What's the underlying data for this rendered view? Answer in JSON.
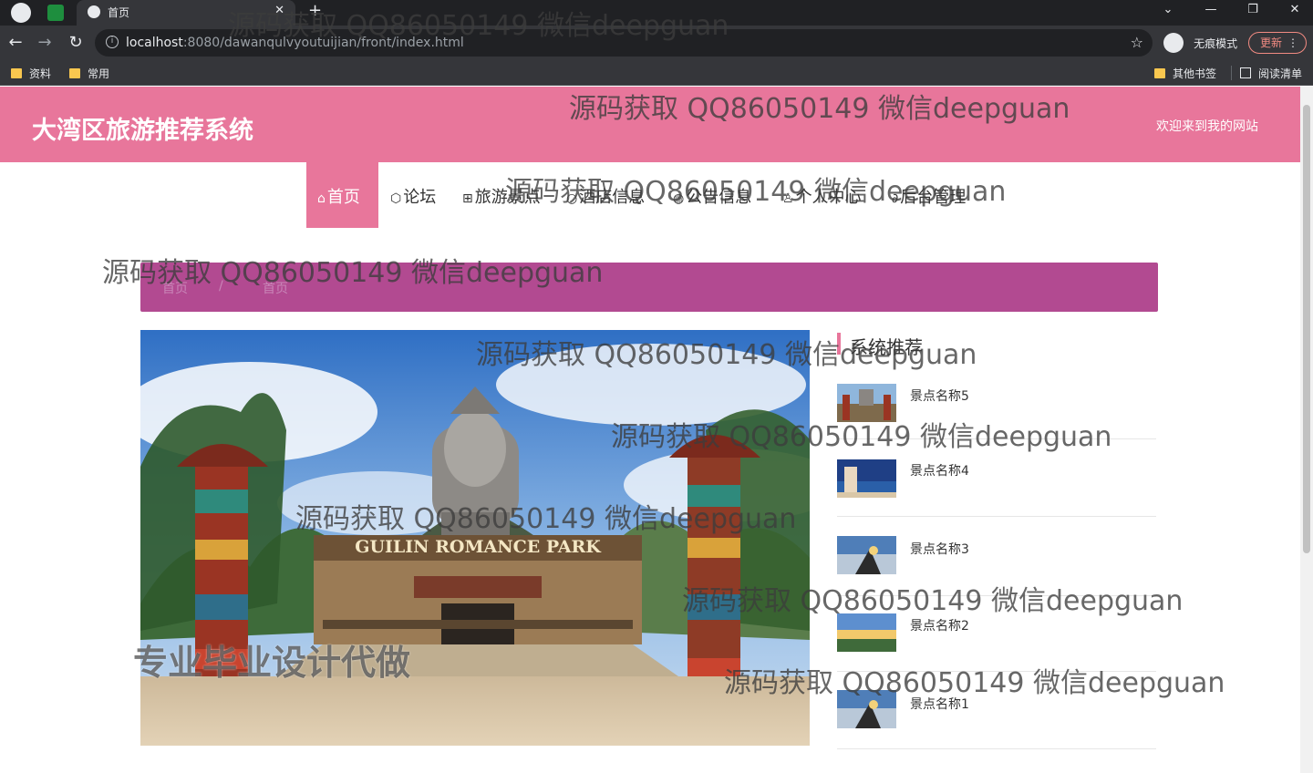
{
  "browser": {
    "tab_title": "首页",
    "url_host": "localhost",
    "url_path": ":8080/dawanqulvyoutuijian/front/index.html",
    "incognito_label": "无痕模式",
    "update_label": "更新",
    "bookmarks": [
      "资料",
      "常用"
    ],
    "other_bookmarks": "其他书签",
    "reading_list": "阅读清单"
  },
  "site": {
    "title": "大湾区旅游推荐系统",
    "welcome": "欢迎来到我的网站"
  },
  "nav": [
    {
      "label": "首页",
      "icon": "home-icon",
      "glyph": "⌂",
      "active": true
    },
    {
      "label": "论坛",
      "icon": "cube-icon",
      "glyph": "⬡",
      "active": false
    },
    {
      "label": "旅游景点",
      "icon": "gift-icon",
      "glyph": "⊞",
      "active": false
    },
    {
      "label": "酒店信息",
      "icon": "circle-icon",
      "glyph": "○",
      "active": false
    },
    {
      "label": "公告信息",
      "icon": "globe-icon",
      "glyph": "◍",
      "active": false
    },
    {
      "label": "个人中心",
      "icon": "user-icon",
      "glyph": "♙",
      "active": false
    },
    {
      "label": "后台管理",
      "icon": "link-icon",
      "glyph": "∂",
      "active": false
    }
  ],
  "breadcrumb": {
    "home": "首页",
    "sep": "/",
    "current": "首页"
  },
  "banner": {
    "sign_text": "GUILIN ROMANCE PARK"
  },
  "sidebar": {
    "title": "系统推荐",
    "items": [
      {
        "name": "景点名称5"
      },
      {
        "name": "景点名称4"
      },
      {
        "name": "景点名称3"
      },
      {
        "name": "景点名称2"
      },
      {
        "name": "景点名称1"
      }
    ]
  },
  "watermarks": {
    "text": "源码获取 QQ86050149 微信deepguan",
    "promo": "专业毕业设计代做"
  },
  "colors": {
    "header_pink": "#e8769b",
    "breadcrumb_purple": "#b24a91"
  }
}
